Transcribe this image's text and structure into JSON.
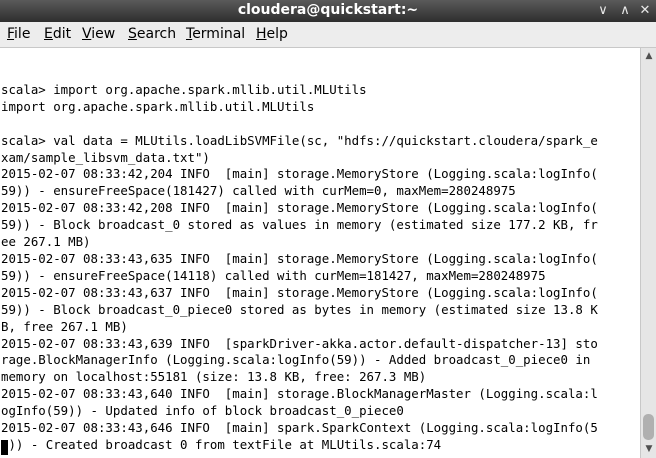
{
  "window": {
    "title": "cloudera@quickstart:~",
    "minimize_glyph": "∨",
    "maximize_glyph": "∧",
    "close_glyph": "✕"
  },
  "menu": {
    "items": [
      {
        "mnemonic": "F",
        "rest": "ile"
      },
      {
        "mnemonic": "E",
        "rest": "dit"
      },
      {
        "mnemonic": "V",
        "rest": "iew"
      },
      {
        "mnemonic": "S",
        "rest": "earch"
      },
      {
        "mnemonic": "T",
        "rest": "erminal"
      },
      {
        "mnemonic": "H",
        "rest": "elp"
      }
    ]
  },
  "terminal": {
    "lines": [
      "",
      "scala> import org.apache.spark.mllib.util.MLUtils",
      "import org.apache.spark.mllib.util.MLUtils",
      "",
      "scala> val data = MLUtils.loadLibSVMFile(sc, \"hdfs://quickstart.cloudera/spark_e",
      "xam/sample_libsvm_data.txt\")",
      "2015-02-07 08:33:42,204 INFO  [main] storage.MemoryStore (Logging.scala:logInfo(",
      "59)) - ensureFreeSpace(181427) called with curMem=0, maxMem=280248975",
      "2015-02-07 08:33:42,208 INFO  [main] storage.MemoryStore (Logging.scala:logInfo(",
      "59)) - Block broadcast_0 stored as values in memory (estimated size 177.2 KB, fr",
      "ee 267.1 MB)",
      "2015-02-07 08:33:43,635 INFO  [main] storage.MemoryStore (Logging.scala:logInfo(",
      "59)) - ensureFreeSpace(14118) called with curMem=181427, maxMem=280248975",
      "2015-02-07 08:33:43,637 INFO  [main] storage.MemoryStore (Logging.scala:logInfo(",
      "59)) - Block broadcast_0_piece0 stored as bytes in memory (estimated size 13.8 K",
      "B, free 267.1 MB)",
      "2015-02-07 08:33:43,639 INFO  [sparkDriver-akka.actor.default-dispatcher-13] sto",
      "rage.BlockManagerInfo (Logging.scala:logInfo(59)) - Added broadcast_0_piece0 in",
      "memory on localhost:55181 (size: 13.8 KB, free: 267.3 MB)",
      "2015-02-07 08:33:43,640 INFO  [main] storage.BlockManagerMaster (Logging.scala:l",
      "ogInfo(59)) - Updated info of block broadcast_0_piece0",
      "2015-02-07 08:33:43,646 INFO  [main] spark.SparkContext (Logging.scala:logInfo(5",
      "9)) - Created broadcast 0 from textFile at MLUtils.scala:74"
    ]
  },
  "scrollbar": {
    "up_glyph": "▲",
    "down_glyph": "▼"
  }
}
